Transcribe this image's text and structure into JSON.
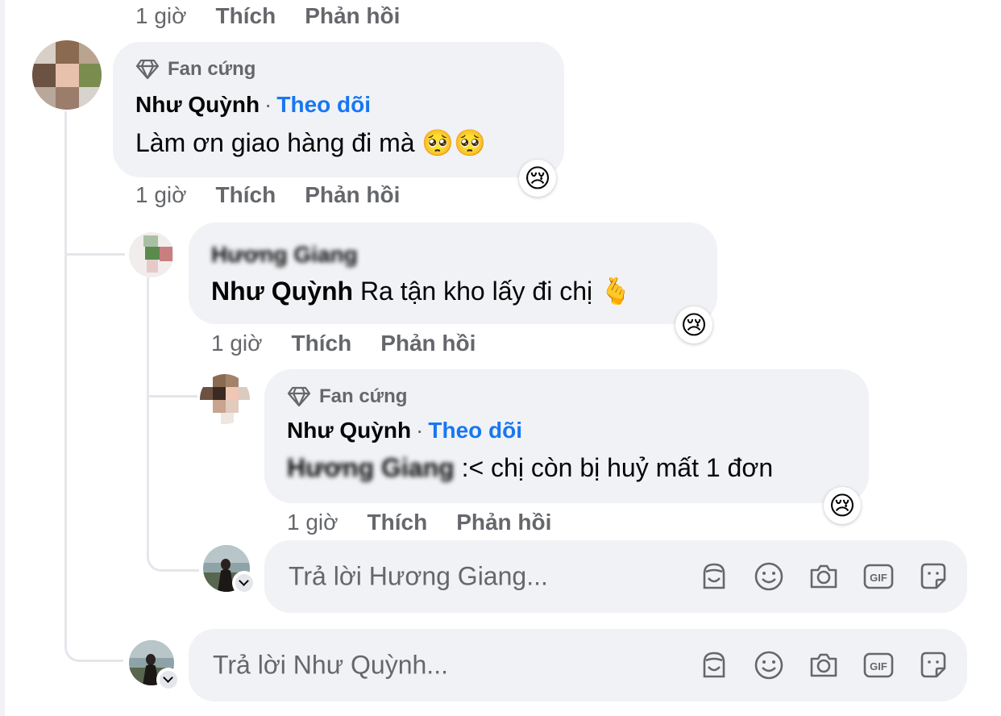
{
  "top_meta": {
    "time": "1 giờ",
    "like": "Thích",
    "reply": "Phản hồi"
  },
  "comment1": {
    "badge": "Fan cứng",
    "author": "Như Quỳnh",
    "separator": "·",
    "follow": "Theo dõi",
    "text": "Làm ơn giao hàng đi mà 🥺🥺",
    "reaction": "😢",
    "meta": {
      "time": "1 giờ",
      "like": "Thích",
      "reply": "Phản hồi"
    }
  },
  "reply1": {
    "author": "Hương Giang",
    "mention": "Như Quỳnh",
    "text": "Ra tận kho lấy đi chị 🫰",
    "reaction": "😢",
    "meta": {
      "time": "1 giờ",
      "like": "Thích",
      "reply": "Phản hồi"
    }
  },
  "reply2": {
    "badge": "Fan cứng",
    "author": "Như Quỳnh",
    "separator": "·",
    "follow": "Theo dõi",
    "mention": "Hương Giang",
    "text": ":< chị còn bị huỷ mất 1 đơn",
    "reaction": "😢",
    "meta": {
      "time": "1 giờ",
      "like": "Thích",
      "reply": "Phản hồi"
    }
  },
  "reply_input_1": {
    "placeholder": "Trả lời Hương Giang..."
  },
  "reply_input_2": {
    "placeholder": "Trả lời Như Quỳnh..."
  },
  "tool_icons": [
    "avatar-sticker-icon",
    "emoji-icon",
    "camera-icon",
    "gif-icon",
    "sticker-icon"
  ],
  "colors": {
    "link": "#1877f2",
    "bubble": "#f0f2f5",
    "muted": "#65676b"
  }
}
